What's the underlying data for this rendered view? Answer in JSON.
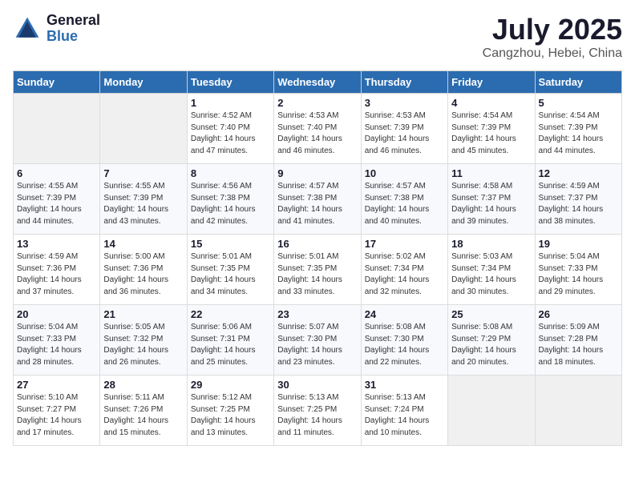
{
  "header": {
    "logo_general": "General",
    "logo_blue": "Blue",
    "month": "July 2025",
    "location": "Cangzhou, Hebei, China"
  },
  "weekdays": [
    "Sunday",
    "Monday",
    "Tuesday",
    "Wednesday",
    "Thursday",
    "Friday",
    "Saturday"
  ],
  "weeks": [
    [
      {
        "day": null
      },
      {
        "day": null
      },
      {
        "day": "1",
        "sunrise": "4:52 AM",
        "sunset": "7:40 PM",
        "daylight": "14 hours and 47 minutes."
      },
      {
        "day": "2",
        "sunrise": "4:53 AM",
        "sunset": "7:40 PM",
        "daylight": "14 hours and 46 minutes."
      },
      {
        "day": "3",
        "sunrise": "4:53 AM",
        "sunset": "7:39 PM",
        "daylight": "14 hours and 46 minutes."
      },
      {
        "day": "4",
        "sunrise": "4:54 AM",
        "sunset": "7:39 PM",
        "daylight": "14 hours and 45 minutes."
      },
      {
        "day": "5",
        "sunrise": "4:54 AM",
        "sunset": "7:39 PM",
        "daylight": "14 hours and 44 minutes."
      }
    ],
    [
      {
        "day": "6",
        "sunrise": "4:55 AM",
        "sunset": "7:39 PM",
        "daylight": "14 hours and 44 minutes."
      },
      {
        "day": "7",
        "sunrise": "4:55 AM",
        "sunset": "7:39 PM",
        "daylight": "14 hours and 43 minutes."
      },
      {
        "day": "8",
        "sunrise": "4:56 AM",
        "sunset": "7:38 PM",
        "daylight": "14 hours and 42 minutes."
      },
      {
        "day": "9",
        "sunrise": "4:57 AM",
        "sunset": "7:38 PM",
        "daylight": "14 hours and 41 minutes."
      },
      {
        "day": "10",
        "sunrise": "4:57 AM",
        "sunset": "7:38 PM",
        "daylight": "14 hours and 40 minutes."
      },
      {
        "day": "11",
        "sunrise": "4:58 AM",
        "sunset": "7:37 PM",
        "daylight": "14 hours and 39 minutes."
      },
      {
        "day": "12",
        "sunrise": "4:59 AM",
        "sunset": "7:37 PM",
        "daylight": "14 hours and 38 minutes."
      }
    ],
    [
      {
        "day": "13",
        "sunrise": "4:59 AM",
        "sunset": "7:36 PM",
        "daylight": "14 hours and 37 minutes."
      },
      {
        "day": "14",
        "sunrise": "5:00 AM",
        "sunset": "7:36 PM",
        "daylight": "14 hours and 36 minutes."
      },
      {
        "day": "15",
        "sunrise": "5:01 AM",
        "sunset": "7:35 PM",
        "daylight": "14 hours and 34 minutes."
      },
      {
        "day": "16",
        "sunrise": "5:01 AM",
        "sunset": "7:35 PM",
        "daylight": "14 hours and 33 minutes."
      },
      {
        "day": "17",
        "sunrise": "5:02 AM",
        "sunset": "7:34 PM",
        "daylight": "14 hours and 32 minutes."
      },
      {
        "day": "18",
        "sunrise": "5:03 AM",
        "sunset": "7:34 PM",
        "daylight": "14 hours and 30 minutes."
      },
      {
        "day": "19",
        "sunrise": "5:04 AM",
        "sunset": "7:33 PM",
        "daylight": "14 hours and 29 minutes."
      }
    ],
    [
      {
        "day": "20",
        "sunrise": "5:04 AM",
        "sunset": "7:33 PM",
        "daylight": "14 hours and 28 minutes."
      },
      {
        "day": "21",
        "sunrise": "5:05 AM",
        "sunset": "7:32 PM",
        "daylight": "14 hours and 26 minutes."
      },
      {
        "day": "22",
        "sunrise": "5:06 AM",
        "sunset": "7:31 PM",
        "daylight": "14 hours and 25 minutes."
      },
      {
        "day": "23",
        "sunrise": "5:07 AM",
        "sunset": "7:30 PM",
        "daylight": "14 hours and 23 minutes."
      },
      {
        "day": "24",
        "sunrise": "5:08 AM",
        "sunset": "7:30 PM",
        "daylight": "14 hours and 22 minutes."
      },
      {
        "day": "25",
        "sunrise": "5:08 AM",
        "sunset": "7:29 PM",
        "daylight": "14 hours and 20 minutes."
      },
      {
        "day": "26",
        "sunrise": "5:09 AM",
        "sunset": "7:28 PM",
        "daylight": "14 hours and 18 minutes."
      }
    ],
    [
      {
        "day": "27",
        "sunrise": "5:10 AM",
        "sunset": "7:27 PM",
        "daylight": "14 hours and 17 minutes."
      },
      {
        "day": "28",
        "sunrise": "5:11 AM",
        "sunset": "7:26 PM",
        "daylight": "14 hours and 15 minutes."
      },
      {
        "day": "29",
        "sunrise": "5:12 AM",
        "sunset": "7:25 PM",
        "daylight": "14 hours and 13 minutes."
      },
      {
        "day": "30",
        "sunrise": "5:13 AM",
        "sunset": "7:25 PM",
        "daylight": "14 hours and 11 minutes."
      },
      {
        "day": "31",
        "sunrise": "5:13 AM",
        "sunset": "7:24 PM",
        "daylight": "14 hours and 10 minutes."
      },
      {
        "day": null
      },
      {
        "day": null
      }
    ]
  ]
}
